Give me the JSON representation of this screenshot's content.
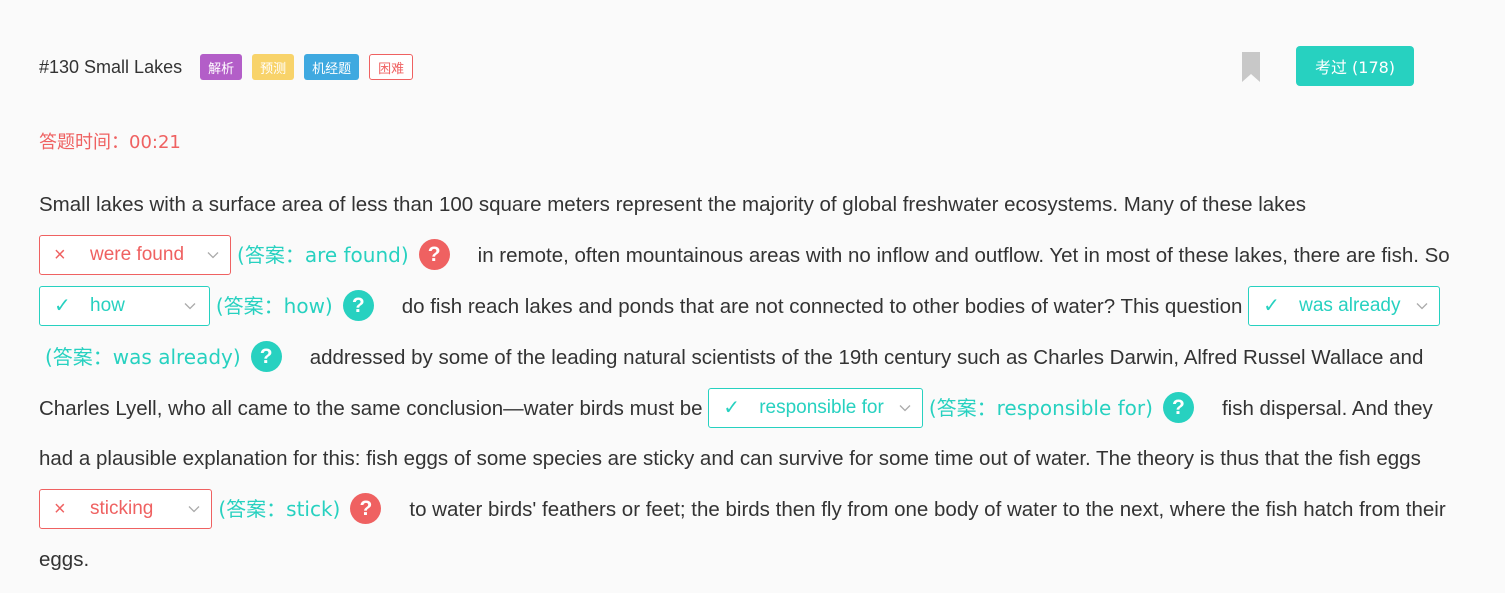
{
  "header": {
    "title": "#130 Small Lakes",
    "tags": [
      "解析",
      "预测",
      "机经题",
      "困难"
    ],
    "pass_button": "考过 (178)"
  },
  "timer": {
    "label": "答题时间：",
    "value": "00:21"
  },
  "passage": {
    "seg0": "Small lakes with a surface area of less than 100 square meters represent the majority of global freshwater ecosystems. Many of these lakes ",
    "seg1": "in remote, often mountainous areas with no inflow and outflow. Yet in most of these lakes, there are fish. So ",
    "seg2": "do fish reach lakes and ponds that are not connected to other bodies of water? This question ",
    "seg3": "addressed by some of the leading natural scientists of the 19th century such as Charles Darwin, Alfred Russel Wallace and Charles Lyell, who all came to the same conclusion—water birds must be ",
    "seg4": "fish dispersal. And they had a plausible explanation for this: fish eggs of some species are sticky and can survive for some time out of water. The theory is thus that the fish eggs ",
    "seg5": "to water birds' feathers or feet; the birds then fly from one body of water to the next, where the fish hatch from their eggs."
  },
  "blanks": [
    {
      "selected": "were found",
      "answer": "(答案：are found)",
      "status": "wrong"
    },
    {
      "selected": "how",
      "answer": "(答案：how)",
      "status": "right"
    },
    {
      "selected": "was already",
      "answer": "(答案：was already)",
      "status": "right"
    },
    {
      "selected": "responsible for",
      "answer": "(答案：responsible for)",
      "status": "right"
    },
    {
      "selected": "sticking",
      "answer": "(答案：stick)",
      "status": "wrong"
    }
  ],
  "icons": {
    "wrong": "×",
    "right": "✓",
    "help": "?"
  },
  "colors": {
    "accent": "#27d1c0",
    "error": "#ef6161",
    "tag_purple": "#b35ec8",
    "tag_yellow": "#f8d36a",
    "tag_blue": "#3fa9e0"
  }
}
